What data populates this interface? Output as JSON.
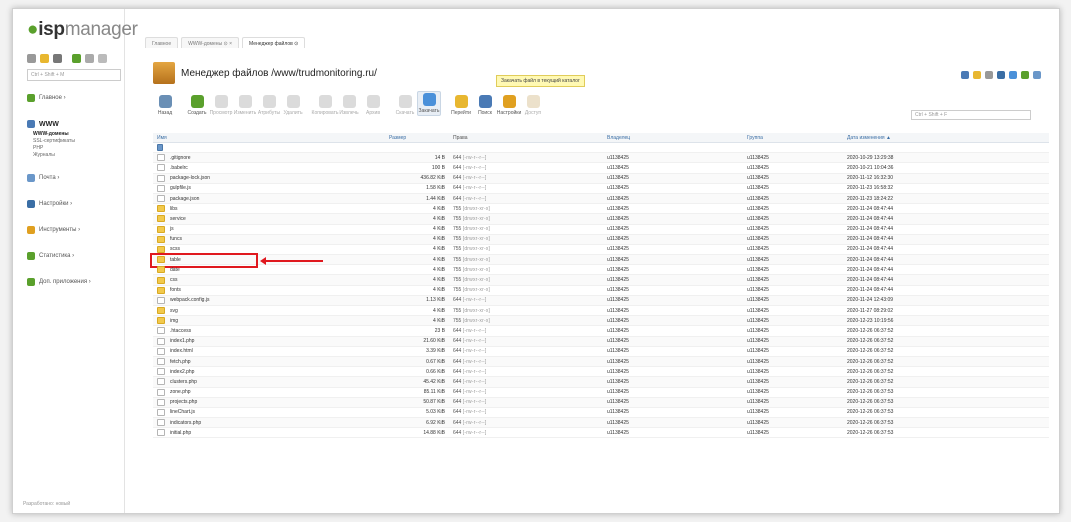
{
  "logo": {
    "prefix": "isp",
    "suffix": "manager",
    "dot_color": "#5aa02c"
  },
  "sidebar": {
    "search_placeholder": "Ctrl + Shift + M",
    "items": [
      {
        "label": "Главное ›",
        "icon": "home-icon"
      },
      {
        "label": "WWW",
        "icon": "globe-icon",
        "active": true,
        "sub": [
          "WWW-домены",
          "SSL-сертификаты",
          "PHP",
          "Журналы"
        ]
      },
      {
        "label": "Почта ›",
        "icon": "mail-icon"
      },
      {
        "label": "Настройки ›",
        "icon": "settings-icon"
      },
      {
        "label": "Инструменты ›",
        "icon": "tools-icon"
      },
      {
        "label": "Статистика ›",
        "icon": "stats-icon"
      },
      {
        "label": "Доп. приложения ›",
        "icon": "apps-icon"
      }
    ],
    "footer": "Разработано: новый"
  },
  "tabs": [
    {
      "label": "Главное"
    },
    {
      "label": "WWW-домены  ⊙  ×"
    },
    {
      "label": "Менеджер файлов ⊙",
      "active": true
    }
  ],
  "header": {
    "title": "Менеджер файлов /www/trudmonitoring.ru/",
    "hint": "Закачать файл в текущий каталог"
  },
  "toolbar": [
    {
      "label": "Назад",
      "icon": "back-icon",
      "color": "#6a8fb5"
    },
    {
      "label": "Создать",
      "icon": "create-icon",
      "color": "#5aa02c"
    },
    {
      "label": "Просмотр",
      "icon": "view-icon",
      "color": "#999",
      "dim": true
    },
    {
      "label": "Изменить",
      "icon": "edit-icon",
      "color": "#999",
      "dim": true
    },
    {
      "label": "Атрибуты",
      "icon": "attributes-icon",
      "color": "#999",
      "dim": true
    },
    {
      "label": "Удалить",
      "icon": "delete-icon",
      "color": "#999",
      "dim": true
    },
    {
      "label": "Копировать",
      "icon": "copy-icon",
      "color": "#999",
      "dim": true
    },
    {
      "label": "Извлечь",
      "icon": "extract-icon",
      "color": "#999",
      "dim": true
    },
    {
      "label": "Архив",
      "icon": "archive-icon",
      "color": "#999",
      "dim": true
    },
    {
      "label": "Скачать",
      "icon": "download-icon",
      "color": "#999",
      "dim": true
    },
    {
      "label": "Закачать",
      "icon": "upload-icon",
      "color": "#4a90d9",
      "highlight": true
    },
    {
      "label": "Перейти",
      "icon": "goto-icon",
      "color": "#e8b730"
    },
    {
      "label": "Поиск",
      "icon": "search-icon",
      "color": "#4a7ab5"
    },
    {
      "label": "Настройки",
      "icon": "settings-icon",
      "color": "#e0a020"
    },
    {
      "label": "Доступ",
      "icon": "access-icon",
      "color": "#c9a86a",
      "dim": true
    }
  ],
  "filter_placeholder": "Ctrl + Shift + F",
  "columns": {
    "name": "Имя",
    "size": "Размер",
    "perm": "Права",
    "owner": "Владелец",
    "group": "Группа",
    "date": "Дата изменения ▲"
  },
  "files": [
    {
      "name": "",
      "type": "up",
      "size": "",
      "perm": "",
      "mask": "",
      "owner": "",
      "group": "",
      "date": ""
    },
    {
      "name": ".gitignore",
      "type": "file",
      "size": "14 B",
      "perm": "644",
      "mask": "[-rw-r--r--]",
      "owner": "u1138425",
      "group": "u1138425",
      "date": "2020-10-29 13:29:38"
    },
    {
      "name": ".babelrc",
      "type": "file",
      "size": "100 B",
      "perm": "644",
      "mask": "[-rw-r--r--]",
      "owner": "u1138425",
      "group": "u1138425",
      "date": "2020-10-21 10:04:36"
    },
    {
      "name": "package-lock.json",
      "type": "file",
      "size": "436.82 KiB",
      "perm": "644",
      "mask": "[-rw-r--r--]",
      "owner": "u1138425",
      "group": "u1138425",
      "date": "2020-11-12 16:32:30"
    },
    {
      "name": "gulpfile.js",
      "type": "file",
      "size": "1.58 KiB",
      "perm": "644",
      "mask": "[-rw-r--r--]",
      "owner": "u1138425",
      "group": "u1138425",
      "date": "2020-11-23 16:58:32"
    },
    {
      "name": "package.json",
      "type": "file",
      "size": "1.44 KiB",
      "perm": "644",
      "mask": "[-rw-r--r--]",
      "owner": "u1138425",
      "group": "u1138425",
      "date": "2020-11-23 18:24:22"
    },
    {
      "name": "libs",
      "type": "dir",
      "size": "4 KiB",
      "perm": "755",
      "mask": "[drwxr-xr-x]",
      "owner": "u1138425",
      "group": "u1138425",
      "date": "2020-11-24 08:47:44"
    },
    {
      "name": "service",
      "type": "dir",
      "size": "4 KiB",
      "perm": "755",
      "mask": "[drwxr-xr-x]",
      "owner": "u1138425",
      "group": "u1138425",
      "date": "2020-11-24 08:47:44"
    },
    {
      "name": "js",
      "type": "dir",
      "size": "4 KiB",
      "perm": "755",
      "mask": "[drwxr-xr-x]",
      "owner": "u1138425",
      "group": "u1138425",
      "date": "2020-11-24 08:47:44"
    },
    {
      "name": "funcs",
      "type": "dir",
      "size": "4 KiB",
      "perm": "755",
      "mask": "[drwxr-xr-x]",
      "owner": "u1138425",
      "group": "u1138425",
      "date": "2020-11-24 08:47:44"
    },
    {
      "name": "scss",
      "type": "dir",
      "size": "4 KiB",
      "perm": "755",
      "mask": "[drwxr-xr-x]",
      "owner": "u1138425",
      "group": "u1138425",
      "date": "2020-11-24 08:47:44"
    },
    {
      "name": "table",
      "type": "dir",
      "size": "4 KiB",
      "perm": "755",
      "mask": "[drwxr-xr-x]",
      "owner": "u1138425",
      "group": "u1138425",
      "date": "2020-11-24 08:47:44",
      "highlight": true
    },
    {
      "name": "date",
      "type": "dir",
      "size": "4 KiB",
      "perm": "755",
      "mask": "[drwxr-xr-x]",
      "owner": "u1138425",
      "group": "u1138425",
      "date": "2020-11-24 08:47:44"
    },
    {
      "name": "css",
      "type": "dir",
      "size": "4 KiB",
      "perm": "755",
      "mask": "[drwxr-xr-x]",
      "owner": "u1138425",
      "group": "u1138425",
      "date": "2020-11-24 08:47:44"
    },
    {
      "name": "fonts",
      "type": "dir",
      "size": "4 KiB",
      "perm": "755",
      "mask": "[drwxr-xr-x]",
      "owner": "u1138425",
      "group": "u1138425",
      "date": "2020-11-24 08:47:44"
    },
    {
      "name": "webpack.config.js",
      "type": "file",
      "size": "1.13 KiB",
      "perm": "644",
      "mask": "[-rw-r--r--]",
      "owner": "u1138425",
      "group": "u1138425",
      "date": "2020-11-24 12:43:09"
    },
    {
      "name": "svg",
      "type": "dir",
      "size": "4 KiB",
      "perm": "755",
      "mask": "[drwxr-xr-x]",
      "owner": "u1138425",
      "group": "u1138425",
      "date": "2020-11-27 08:29:02"
    },
    {
      "name": "img",
      "type": "dir",
      "size": "4 KiB",
      "perm": "755",
      "mask": "[drwxr-xr-x]",
      "owner": "u1138425",
      "group": "u1138425",
      "date": "2020-12-23 10:19:56"
    },
    {
      "name": ".htaccess",
      "type": "file",
      "size": "23 B",
      "perm": "644",
      "mask": "[-rw-r--r--]",
      "owner": "u1138425",
      "group": "u1138425",
      "date": "2020-12-26 06:37:52"
    },
    {
      "name": "index1.php",
      "type": "file",
      "size": "21.60 KiB",
      "perm": "644",
      "mask": "[-rw-r--r--]",
      "owner": "u1138425",
      "group": "u1138425",
      "date": "2020-12-26 06:37:52"
    },
    {
      "name": "index.html",
      "type": "file",
      "size": "3.39 KiB",
      "perm": "644",
      "mask": "[-rw-r--r--]",
      "owner": "u1138425",
      "group": "u1138425",
      "date": "2020-12-26 06:37:52"
    },
    {
      "name": "fetch.php",
      "type": "file",
      "size": "0.67 KiB",
      "perm": "644",
      "mask": "[-rw-r--r--]",
      "owner": "u1138425",
      "group": "u1138425",
      "date": "2020-12-26 06:37:52"
    },
    {
      "name": "index2.php",
      "type": "file",
      "size": "0.66 KiB",
      "perm": "644",
      "mask": "[-rw-r--r--]",
      "owner": "u1138425",
      "group": "u1138425",
      "date": "2020-12-26 06:37:52"
    },
    {
      "name": "clusters.php",
      "type": "file",
      "size": "45.42 KiB",
      "perm": "644",
      "mask": "[-rw-r--r--]",
      "owner": "u1138425",
      "group": "u1138425",
      "date": "2020-12-26 06:37:52"
    },
    {
      "name": "zone.php",
      "type": "file",
      "size": "85.11 KiB",
      "perm": "644",
      "mask": "[-rw-r--r--]",
      "owner": "u1138425",
      "group": "u1138425",
      "date": "2020-12-26 06:37:53"
    },
    {
      "name": "projects.php",
      "type": "file",
      "size": "50.87 KiB",
      "perm": "644",
      "mask": "[-rw-r--r--]",
      "owner": "u1138425",
      "group": "u1138425",
      "date": "2020-12-26 06:37:53"
    },
    {
      "name": "lineChart.js",
      "type": "file",
      "size": "5.03 KiB",
      "perm": "644",
      "mask": "[-rw-r--r--]",
      "owner": "u1138425",
      "group": "u1138425",
      "date": "2020-12-26 06:37:53"
    },
    {
      "name": "indicators.php",
      "type": "file",
      "size": "6.92 KiB",
      "perm": "644",
      "mask": "[-rw-r--r--]",
      "owner": "u1138425",
      "group": "u1138425",
      "date": "2020-12-26 06:37:53"
    },
    {
      "name": "initial.php",
      "type": "file",
      "size": "14.88 KiB",
      "perm": "644",
      "mask": "[-rw-r--r--]",
      "owner": "u1138425",
      "group": "u1138425",
      "date": "2020-12-26 06:37:53"
    }
  ]
}
